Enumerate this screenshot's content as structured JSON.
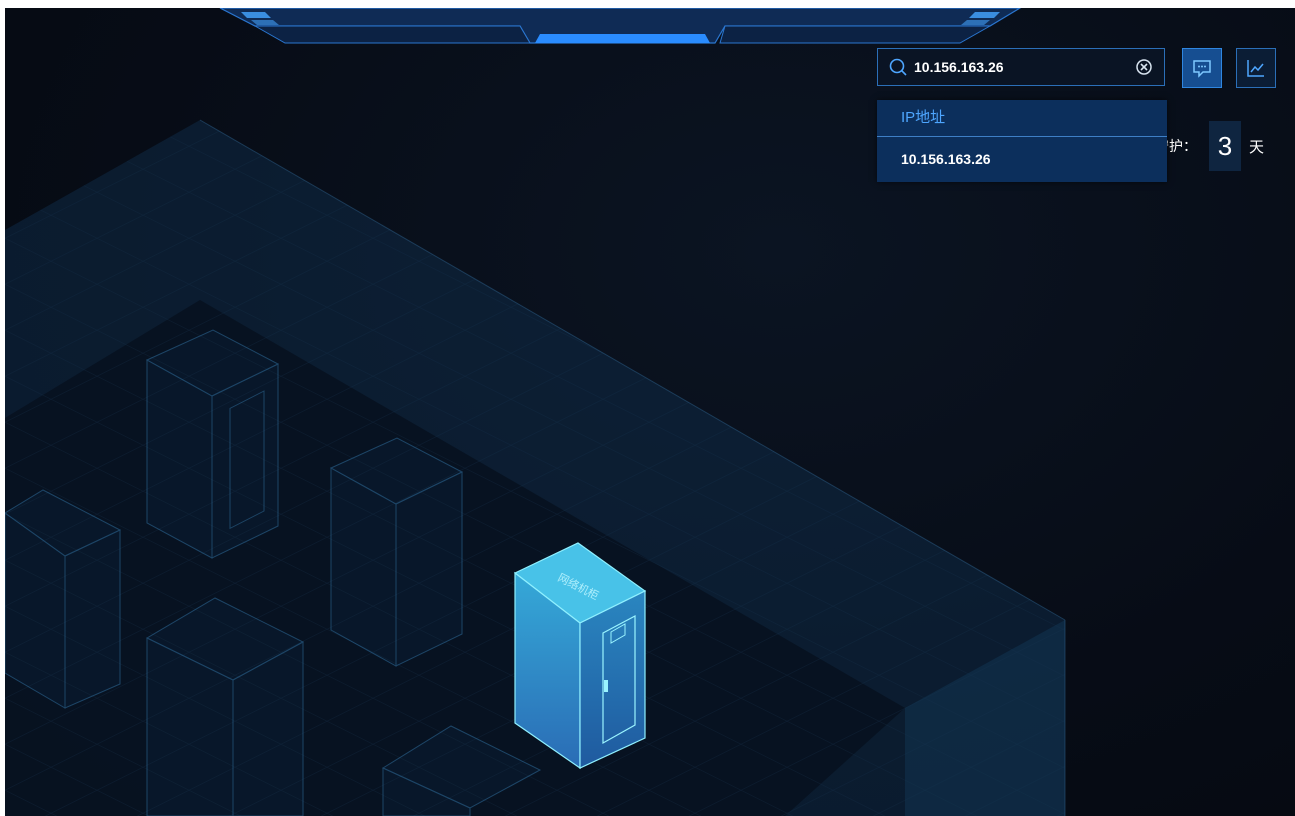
{
  "search": {
    "value": "10.156.163.26",
    "placeholder": ""
  },
  "dropdown": {
    "header": "IP地址",
    "items": [
      "10.156.163.26"
    ]
  },
  "guard": {
    "label": "守护：",
    "value": "3",
    "unit": "天"
  },
  "cabinet": {
    "label": "网络机柜"
  },
  "icons": {
    "search": "search-icon",
    "clear": "clear-circle-icon",
    "message": "message-icon",
    "chart": "line-chart-icon"
  },
  "colors": {
    "background": "#070c16",
    "accent": "#2f86e0",
    "highlight_cabinet": "#2f9bd4",
    "dropdown_bg": "#0c2f5c",
    "dropdown_header_text": "#4ea6ff"
  }
}
